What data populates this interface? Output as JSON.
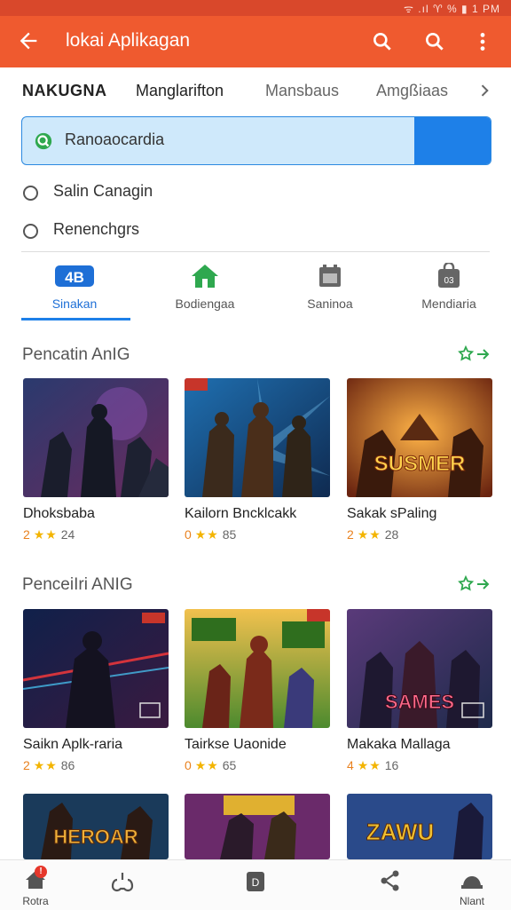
{
  "status_bar": {
    "text": "ᯤ .ıl ♈ % ▮ 1 PM"
  },
  "app_bar": {
    "title": "lokai Aplikagan"
  },
  "top_tabs": [
    {
      "label": "NAKUGNA"
    },
    {
      "label": "Manglarifton"
    },
    {
      "label": "Mansbaus"
    },
    {
      "label": "Amgßiaas"
    }
  ],
  "search": {
    "value": "Ranoaocardia"
  },
  "options": [
    {
      "label": "Salin Canagin"
    },
    {
      "label": "Renenchgrs"
    }
  ],
  "categories": [
    {
      "label": "Sinakan",
      "icon": "apps-logo-icon"
    },
    {
      "label": "Bodiengaa",
      "icon": "home-icon"
    },
    {
      "label": "Saninoa",
      "icon": "calendar-icon"
    },
    {
      "label": "Mendiaria",
      "icon": "bag-icon"
    }
  ],
  "sections": [
    {
      "title": "Pencatin AnIG",
      "items": [
        {
          "name": "Dhoksbaba",
          "rating_num": "2",
          "stars": "★★",
          "count": "24",
          "thumb_text": ""
        },
        {
          "name": "Kailorn Bncklcakk",
          "rating_num": "0",
          "stars": "★★",
          "count": "85",
          "thumb_text": ""
        },
        {
          "name": "Sakak sPaling",
          "rating_num": "2",
          "stars": "★★",
          "count": "28",
          "thumb_text": "SUSMER"
        }
      ]
    },
    {
      "title": "PenceiIri ANIG",
      "items": [
        {
          "name": "Saikn Aplk-raria",
          "rating_num": "2",
          "stars": "★★",
          "count": "86",
          "thumb_text": ""
        },
        {
          "name": "Tairkse Uaonide",
          "rating_num": "0",
          "stars": "★★",
          "count": "65",
          "thumb_text": ""
        },
        {
          "name": "Makaka Mallaga",
          "rating_num": "4",
          "stars": "★★",
          "count": "16",
          "thumb_text": "SAMES"
        }
      ]
    }
  ],
  "third_row_thumbs": [
    {
      "thumb_text": "HEROAR"
    },
    {
      "thumb_text": ""
    },
    {
      "thumb_text": "ZAWU"
    }
  ],
  "bottom_nav": [
    {
      "label": "Rotra",
      "badge": "!"
    },
    {
      "label": ""
    },
    {
      "label": ""
    },
    {
      "label": ""
    },
    {
      "label": "Nlant"
    }
  ],
  "colors": {
    "accent": "#ef5a2f",
    "primary_blue": "#1e80e8",
    "star": "#f3b400"
  }
}
